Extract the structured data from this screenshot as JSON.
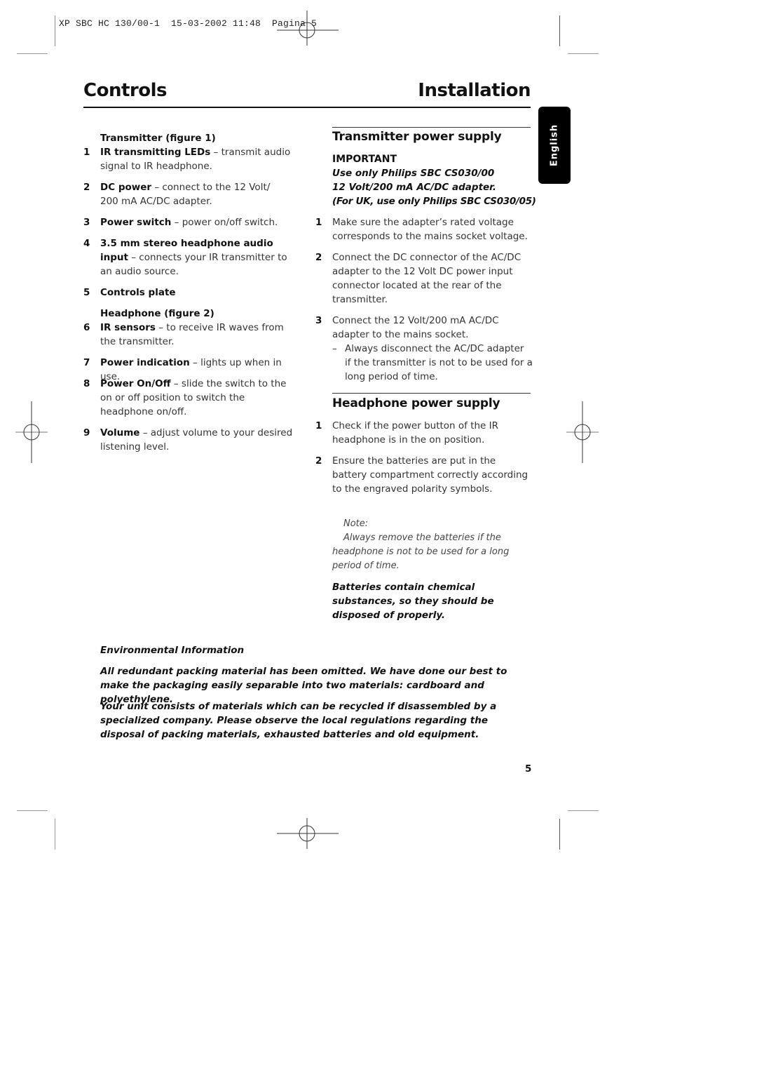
{
  "slug": "XP SBC HC 130/00-1  15-03-2002 11:48  Pagina 5",
  "header": {
    "left_title": "Controls",
    "right_title": "Installation",
    "language_tab": "English"
  },
  "controls": {
    "transmitter_heading": "Transmitter (figure 1)",
    "headphone_heading": "Headphone (figure 2)",
    "items": [
      {
        "num": "1",
        "term": "IR transmitting LEDs",
        "desc": " – transmit audio signal to IR headphone."
      },
      {
        "num": "2",
        "term": "DC power",
        "desc": " – connect to the 12 Volt/ 200 mA AC/DC adapter."
      },
      {
        "num": "3",
        "term": "Power switch",
        "desc": " – power on/off switch."
      },
      {
        "num": "4",
        "term": "3.5 mm stereo headphone audio input",
        "desc": " – connects your IR transmitter to an audio source."
      },
      {
        "num": "5",
        "term": "Controls plate",
        "desc": ""
      },
      {
        "num": "6",
        "term": "IR sensors",
        "desc": " – to receive IR waves from the transmitter."
      },
      {
        "num": "7",
        "term": "Power indication",
        "desc": " – lights up when in use."
      },
      {
        "num": "8",
        "term": "Power On/Off",
        "desc": " – slide the switch to the on or off position to switch the headphone on/off."
      },
      {
        "num": "9",
        "term": "Volume",
        "desc": " – adjust volume to your desired listening level."
      }
    ]
  },
  "installation": {
    "transmitter_section": {
      "heading": "Transmitter power supply",
      "important_label": "IMPORTANT",
      "important_lines": [
        "Use only Philips SBC CS030/00",
        "12 Volt/200 mA AC/DC adapter.",
        "(For UK, use only Philips SBC CS030/05)"
      ],
      "steps": [
        {
          "num": "1",
          "text": "Make sure the adapter’s rated voltage corresponds to the mains socket voltage."
        },
        {
          "num": "2",
          "text": "Connect the DC connector of the AC/DC adapter to the 12 Volt DC power input connector located at the rear of the transmitter."
        },
        {
          "num": "3",
          "text": "Connect the 12 Volt/200 mA AC/DC adapter to the mains socket."
        }
      ],
      "sub_note": "Always disconnect the AC/DC adapter if the transmitter is not to be used for a long period of time."
    },
    "headphone_section": {
      "heading": "Headphone power supply",
      "steps": [
        {
          "num": "1",
          "text": "Check if the power button of the IR headphone is in the on position."
        },
        {
          "num": "2",
          "text": "Ensure the batteries are put in the battery compartment correctly according to the engraved polarity symbols."
        }
      ],
      "note_label": "Note:",
      "note_text": "Always remove the batteries if the headphone is not to be used for a long period of time.",
      "warning": "Batteries contain chemical substances, so they should be disposed of properly."
    }
  },
  "environment": {
    "heading": "Environmental Information",
    "para1": "All redundant packing material has been omitted. We have done our best to make the packaging easily separable into two materials: cardboard and polyethylene.",
    "para2": "Your unit consists of materials which can be recycled if disassembled by a specialized company. Please observe the local regulations regarding the disposal of packing materials, exhausted batteries and old equipment."
  },
  "page_number": "5"
}
